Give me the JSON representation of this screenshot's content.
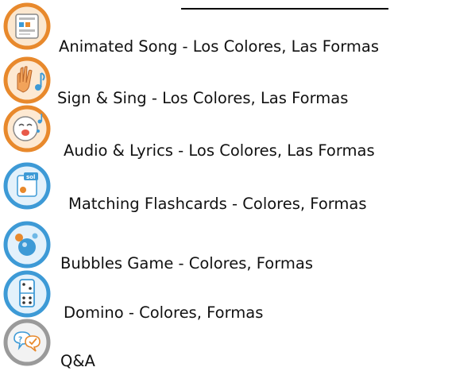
{
  "activities": [
    {
      "label": "Animated Song - Los Colores, Las Formas",
      "icon": "animated-song-icon",
      "ring": "#e8892c"
    },
    {
      "label": "Sign & Sing - Los Colores, Las Formas",
      "icon": "sign-language-hand-icon",
      "ring": "#e8892c"
    },
    {
      "label": "Audio & Lyrics - Los Colores, Las Formas",
      "icon": "singing-face-icon",
      "ring": "#e8892c"
    },
    {
      "label": "Matching Flashcards - Colores, Formas",
      "icon": "flashcards-icon",
      "ring": "#3d9ad6"
    },
    {
      "label": "Bubbles Game - Colores, Formas",
      "icon": "bubbles-icon",
      "ring": "#3d9ad6"
    },
    {
      "label": "Domino - Colores, Formas",
      "icon": "domino-icon",
      "ring": "#3d9ad6"
    },
    {
      "label": "Q&A",
      "icon": "speech-bubbles-icon",
      "ring": "#9a9a9a"
    }
  ]
}
